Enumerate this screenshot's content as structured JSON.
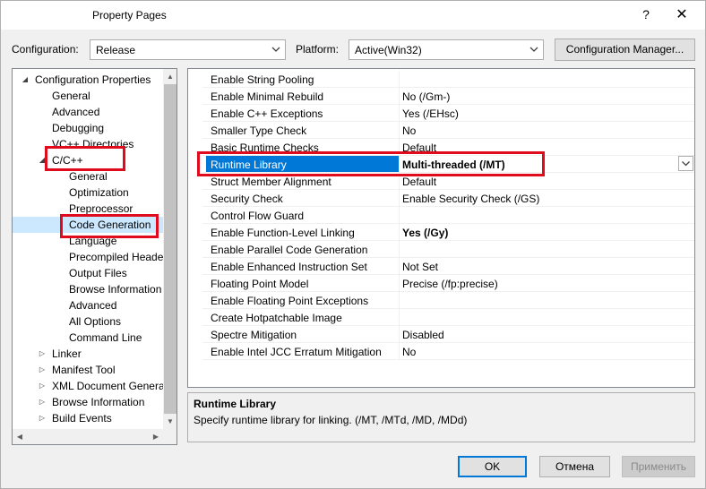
{
  "window": {
    "title": "Property Pages",
    "help_glyph": "?",
    "close_glyph": "✕"
  },
  "toolbar": {
    "configuration_label": "Configuration:",
    "configuration_value": "Release",
    "platform_label": "Platform:",
    "platform_value": "Active(Win32)",
    "config_manager_label": "Configuration Manager..."
  },
  "tree": {
    "items": [
      {
        "label": "Configuration Properties",
        "expander": "open"
      },
      {
        "label": "General"
      },
      {
        "label": "Advanced"
      },
      {
        "label": "Debugging"
      },
      {
        "label": "VC++ Directories"
      },
      {
        "label": "C/C++",
        "expander": "open"
      },
      {
        "label": "General"
      },
      {
        "label": "Optimization"
      },
      {
        "label": "Preprocessor"
      },
      {
        "label": "Code Generation",
        "selected": true
      },
      {
        "label": "Language"
      },
      {
        "label": "Precompiled Heade"
      },
      {
        "label": "Output Files"
      },
      {
        "label": "Browse Information"
      },
      {
        "label": "Advanced"
      },
      {
        "label": "All Options"
      },
      {
        "label": "Command Line"
      },
      {
        "label": "Linker",
        "expander": "closed"
      },
      {
        "label": "Manifest Tool",
        "expander": "closed"
      },
      {
        "label": "XML Document Genera",
        "expander": "closed"
      },
      {
        "label": "Browse Information",
        "expander": "closed"
      },
      {
        "label": "Build Events",
        "expander": "closed"
      }
    ]
  },
  "grid": {
    "rows": [
      {
        "name": "Enable String Pooling",
        "value": ""
      },
      {
        "name": "Enable Minimal Rebuild",
        "value": "No (/Gm-)"
      },
      {
        "name": "Enable C++ Exceptions",
        "value": "Yes (/EHsc)"
      },
      {
        "name": "Smaller Type Check",
        "value": "No"
      },
      {
        "name": "Basic Runtime Checks",
        "value": "Default"
      },
      {
        "name": "Runtime Library",
        "value": "Multi-threaded (/MT)",
        "selected": true,
        "bold": true
      },
      {
        "name": "Struct Member Alignment",
        "value": "Default"
      },
      {
        "name": "Security Check",
        "value": "Enable Security Check (/GS)"
      },
      {
        "name": "Control Flow Guard",
        "value": ""
      },
      {
        "name": "Enable Function-Level Linking",
        "value": "Yes (/Gy)",
        "bold": true
      },
      {
        "name": "Enable Parallel Code Generation",
        "value": ""
      },
      {
        "name": "Enable Enhanced Instruction Set",
        "value": "Not Set"
      },
      {
        "name": "Floating Point Model",
        "value": "Precise (/fp:precise)"
      },
      {
        "name": "Enable Floating Point Exceptions",
        "value": ""
      },
      {
        "name": "Create Hotpatchable Image",
        "value": ""
      },
      {
        "name": "Spectre Mitigation",
        "value": "Disabled"
      },
      {
        "name": "Enable Intel JCC Erratum Mitigation",
        "value": "No"
      }
    ]
  },
  "description": {
    "title": "Runtime Library",
    "text": "Specify runtime library for linking.     (/MT, /MTd, /MD, /MDd)"
  },
  "buttons": {
    "ok": "OK",
    "cancel": "Отмена",
    "apply": "Применить"
  },
  "colors": {
    "selection": "#0078d7",
    "highlight_box": "#e00b1c",
    "tree_selected": "#cce8ff"
  }
}
